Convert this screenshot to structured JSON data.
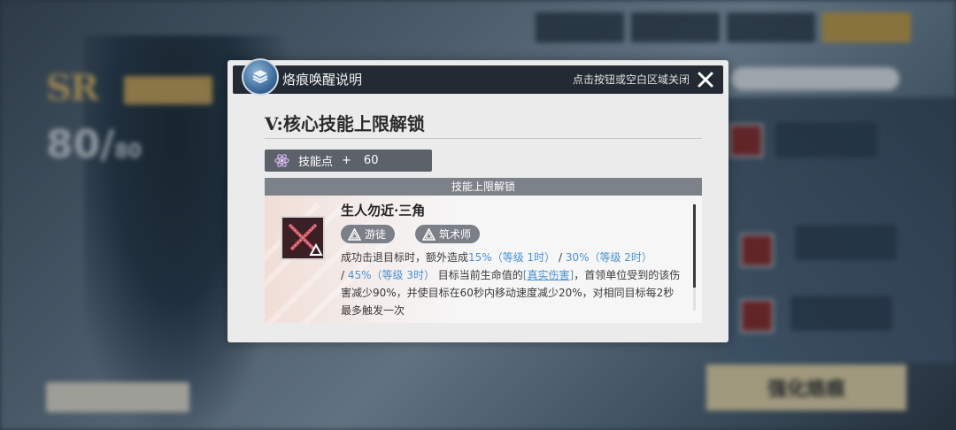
{
  "background": {
    "tabs": [
      "",
      "",
      "",
      ""
    ],
    "rarity": "SR",
    "level": "80/",
    "level_max": "80",
    "char_name": "",
    "enhance_button": "强化烙痕"
  },
  "modal": {
    "title": "烙痕唤醒说明",
    "close_hint": "点击按钮或空白区域关闭",
    "section_title": "V:核心技能上限解锁",
    "skill_points": {
      "label": "技能点",
      "plus": "+",
      "value": "60"
    },
    "unlock_header": "技能上限解锁",
    "skill": {
      "name": "生人勿近·三角",
      "tags": [
        "游徒",
        "筑术师"
      ],
      "desc": {
        "p1": "成功击退目标时，额外造成",
        "v1": "15%（等级 1时）",
        "sep1": " / ",
        "v2": "30%（等级 2时）",
        "sep2": " / ",
        "v3": "45%（等级 3时）",
        "p2": "  目标当前生命值的",
        "link": "[真实伤害]",
        "p3": "，首领单位受到的该伤害减少90%，并使目标在60秒内移动速度减少20%，对相同目标每2秒最多触发一次"
      }
    }
  },
  "colors": {
    "header_bg": "#242a33",
    "highlight": "#4a92d1",
    "accent_gold": "#c8a24a"
  }
}
